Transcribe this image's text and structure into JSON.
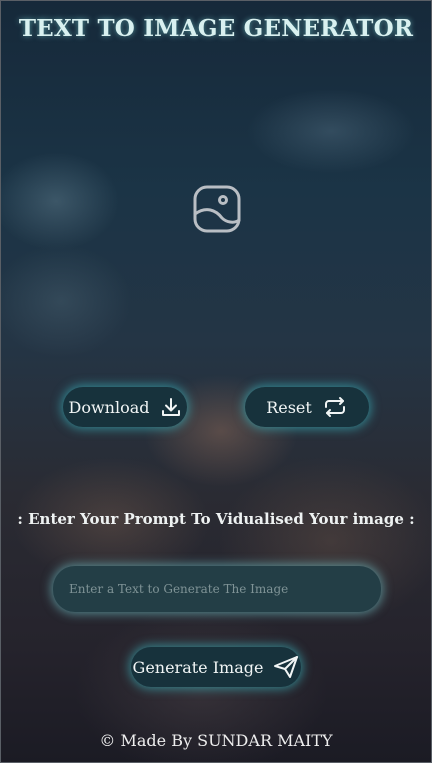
{
  "header": {
    "title": "TEXT TO IMAGE GENERATOR"
  },
  "preview": {
    "icon": "image-icon"
  },
  "actions": {
    "download_label": "Download",
    "download_icon": "download-icon",
    "reset_label": "Reset",
    "reset_icon": "repeat-icon"
  },
  "prompt": {
    "label": ": Enter Your Prompt To Vidualised Your image :",
    "placeholder": "Enter a Text to Generate The Image",
    "value": ""
  },
  "generate": {
    "label": "Generate Image",
    "icon": "send-icon"
  },
  "footer": {
    "credit": "© Made By SUNDAR MAITY"
  },
  "colors": {
    "title": "#d9f1f0",
    "button_bg": "#17323c",
    "button_glow": "#3cc8d2",
    "input_bg": "#233e46"
  }
}
